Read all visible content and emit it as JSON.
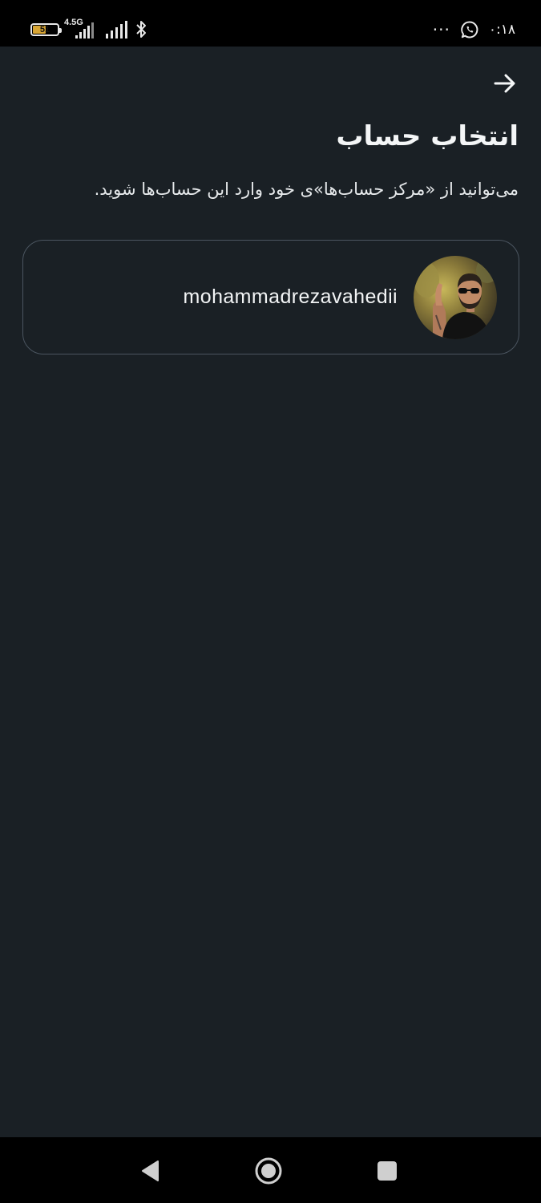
{
  "status_bar": {
    "time": "۰:۱۸",
    "battery_level": "51",
    "network_type": "4.5G",
    "more_glyph": "···",
    "icons": [
      "battery-icon",
      "signal-icon",
      "signal-icon",
      "bluetooth-icon",
      "more-dots-icon",
      "whatsapp-icon"
    ]
  },
  "header": {
    "back_icon": "arrow-right-icon",
    "title": "انتخاب حساب",
    "subtitle": "می‌توانید از «مرکز حساب‌ها»ی خود وارد این حساب‌ها شوید."
  },
  "accounts": [
    {
      "username": "mohammadrezavahedii",
      "avatar_icon": "profile-photo"
    }
  ],
  "nav_bar": {
    "icons": [
      "back-triangle-icon",
      "home-circle-icon",
      "recents-square-icon"
    ]
  },
  "colors": {
    "background": "#1a2025",
    "card_border": "#4b5560",
    "text": "#f2f4f5",
    "bars": "#000000"
  }
}
